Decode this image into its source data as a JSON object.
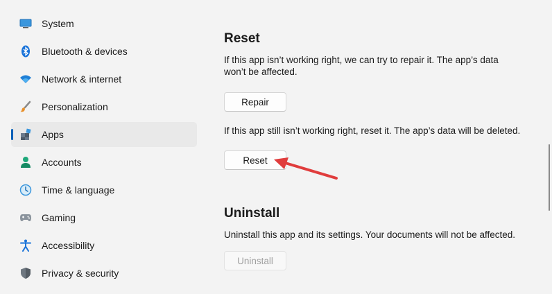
{
  "sidebar": {
    "items": [
      {
        "label": "System",
        "icon": "monitor-icon",
        "active": false
      },
      {
        "label": "Bluetooth & devices",
        "icon": "bluetooth-icon",
        "active": false
      },
      {
        "label": "Network & internet",
        "icon": "wifi-icon",
        "active": false
      },
      {
        "label": "Personalization",
        "icon": "paintbrush-icon",
        "active": false
      },
      {
        "label": "Apps",
        "icon": "apps-icon",
        "active": true
      },
      {
        "label": "Accounts",
        "icon": "person-icon",
        "active": false
      },
      {
        "label": "Time & language",
        "icon": "clock-globe-icon",
        "active": false
      },
      {
        "label": "Gaming",
        "icon": "gamepad-icon",
        "active": false
      },
      {
        "label": "Accessibility",
        "icon": "accessibility-icon",
        "active": false
      },
      {
        "label": "Privacy & security",
        "icon": "shield-icon",
        "active": false
      }
    ]
  },
  "reset_section": {
    "title": "Reset",
    "repair_desc_line1": "If this app isn’t working right, we can try to repair it. The app’s data",
    "repair_desc_line2": "won’t be affected.",
    "repair_button": "Repair",
    "reset_desc": "If this app still isn’t working right, reset it. The app’s data will be deleted.",
    "reset_button": "Reset"
  },
  "uninstall_section": {
    "title": "Uninstall",
    "desc": "Uninstall this app and its settings. Your documents will not be affected.",
    "uninstall_button": "Uninstall"
  },
  "colors": {
    "accent": "#005fb8",
    "annotation_arrow": "#e03c3c"
  }
}
